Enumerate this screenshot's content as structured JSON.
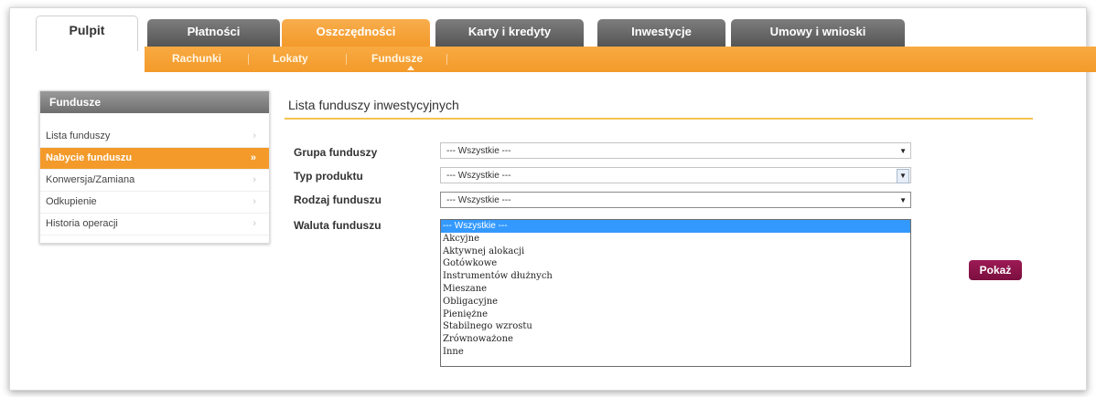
{
  "tabs": {
    "home": "Pulpit",
    "items": [
      {
        "label": "Płatności"
      },
      {
        "label": "Oszczędności"
      },
      {
        "label": "Karty i kredyty"
      },
      {
        "label": "Inwestycje"
      },
      {
        "label": "Umowy i wnioski"
      }
    ],
    "active_color": "#f39a2a"
  },
  "subnav": {
    "items": [
      {
        "label": "Rachunki"
      },
      {
        "label": "Lokaty"
      },
      {
        "label": "Fundusze"
      }
    ],
    "active": "Fundusze"
  },
  "sidebar": {
    "title": "Fundusze",
    "items": [
      {
        "label": "Lista funduszy"
      },
      {
        "label": "Nabycie funduszu"
      },
      {
        "label": "Konwersja/Zamiana"
      },
      {
        "label": "Odkupienie"
      },
      {
        "label": "Historia operacji"
      }
    ],
    "chevron": "›",
    "active_chevron": "»"
  },
  "main": {
    "title": "Lista funduszy inwestycyjnych",
    "fields": [
      {
        "label": "Grupa funduszy",
        "value": "--- Wszystkie ---"
      },
      {
        "label": "Typ produktu",
        "value": "--- Wszystkie ---"
      },
      {
        "label": "Rodzaj funduszu",
        "value": "--- Wszystkie ---"
      },
      {
        "label": "Waluta funduszu",
        "value": ""
      }
    ],
    "dropdown_options": [
      "--- Wszystkie ---",
      "Akcyjne",
      "Aktywnej alokacji",
      "Gotówkowe",
      "Instrumentów dłużnych",
      "Mieszane",
      "Obligacyjne",
      "Pieniężne",
      "Stabilnego wzrostu",
      "Zrównoważone",
      "Inne"
    ],
    "show_button": "Pokaż"
  }
}
